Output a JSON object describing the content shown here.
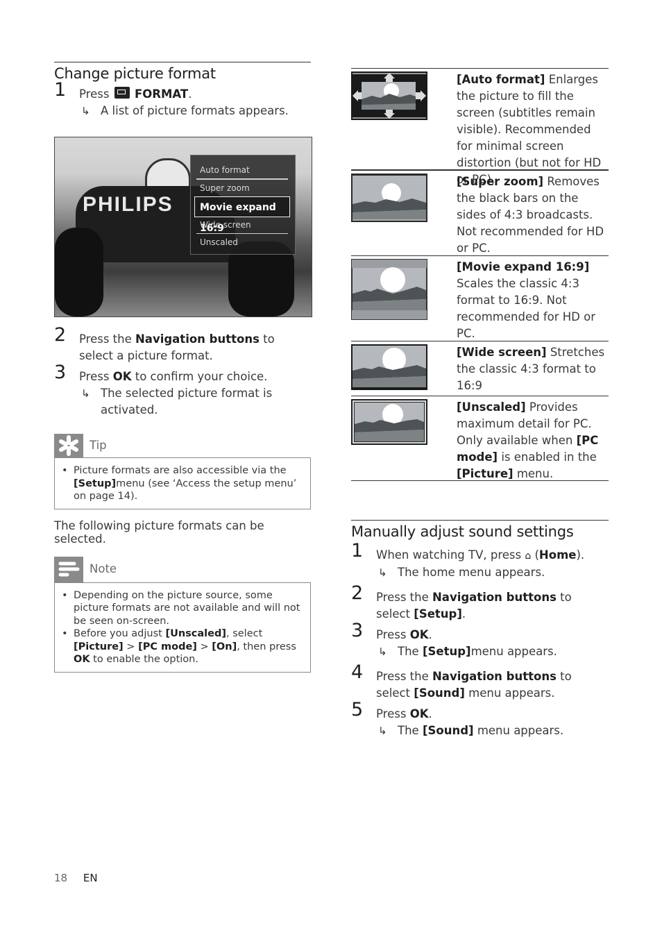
{
  "left": {
    "title": "Change picture format",
    "steps": [
      {
        "num": "1",
        "pre": "Press",
        "icon": "format-icon",
        "bold": "FORMAT",
        "post": ".",
        "result": "A list of picture formats appears."
      },
      {
        "num": "2",
        "pre": "Press the",
        "bold": "Navigation buttons",
        "post": "to select a picture format."
      },
      {
        "num": "3",
        "pre": "Press",
        "bold": "OK",
        "post": "to confirm your choice.",
        "result": "The selected picture format is activated."
      }
    ],
    "screenshot": {
      "brand_text": "PHILIPS",
      "menu_items": [
        "Auto format",
        "Super zoom",
        "Movie expand 16:9",
        "Wide screen",
        "Unscaled"
      ],
      "selected_item": "Movie expand 16:9"
    },
    "tip": {
      "label": "Tip",
      "icon": "asterisk-icon",
      "text_pre": "Picture formats are also accessible via the",
      "text_bold": "[Setup]",
      "text_post": "menu (see ‘Access the setup menu’ on page 14)."
    },
    "following_text": "The following picture formats can be selected.",
    "note": {
      "label": "Note",
      "icon": "note-lines-icon",
      "bullet1": "Depending on the picture source, some picture formats are not available and will not be seen on-screen.",
      "bullet2": {
        "t1": "Before you adjust",
        "b1": "[Unscaled]",
        "t2": ", select",
        "b2": "[Picture]",
        "t3": ">",
        "b3": "[PC mode]",
        "t4": ">",
        "b4": "[On]",
        "t5": ", then press",
        "b5": "OK",
        "t6": "to enable the option."
      }
    }
  },
  "formats": [
    {
      "name": "[Auto format]",
      "desc": "Enlarges the picture to fill the screen (subtitles remain visible). Recommended for minimal screen distortion (but not for HD or PC).",
      "thumb": "auto-format"
    },
    {
      "name": "[Super zoom]",
      "desc": "Removes the black bars on the sides of 4:3 broadcasts. Not recommended for HD or PC.",
      "thumb": "super-zoom"
    },
    {
      "name": "[Movie expand 16:9]",
      "desc": "Scales the classic 4:3 format to 16:9. Not recommended for HD or PC.",
      "thumb": "movie-expand"
    },
    {
      "name": "[Wide screen]",
      "desc": "Stretches the classic 4:3 format to 16:9",
      "thumb": "wide-screen"
    },
    {
      "name": "[Unscaled]",
      "desc_pre": "Provides maximum detail for PC. Only available when",
      "b1": "[PC mode]",
      "mid": "is enabled in the",
      "b2": "[Picture]",
      "post": "menu.",
      "thumb": "unscaled"
    }
  ],
  "sound": {
    "title": "Manually adjust sound settings",
    "steps": [
      {
        "num": "1",
        "pre": "When watching TV, press",
        "icon": "home-icon",
        "bold": "Home",
        "result": "The home menu appears."
      },
      {
        "num": "2",
        "pre": "Press the",
        "bold": "Navigation buttons",
        "post": "to select",
        "bold2": "[Setup]",
        "post2": "."
      },
      {
        "num": "3",
        "pre": "Press",
        "bold": "OK",
        "post": ".",
        "result_pre": "The",
        "result_bold": "[Setup]",
        "result_post": "menu appears."
      },
      {
        "num": "4",
        "pre": "Press the",
        "bold": "Navigation buttons",
        "post": "to select",
        "bold2": "[Sound]",
        "post2": "menu appears."
      },
      {
        "num": "5",
        "pre": "Press",
        "bold": "OK",
        "post": ".",
        "result_pre": "The",
        "result_bold": "[Sound]",
        "result_post": "menu appears."
      }
    ]
  },
  "footer": {
    "page": "18",
    "lang": "EN"
  }
}
